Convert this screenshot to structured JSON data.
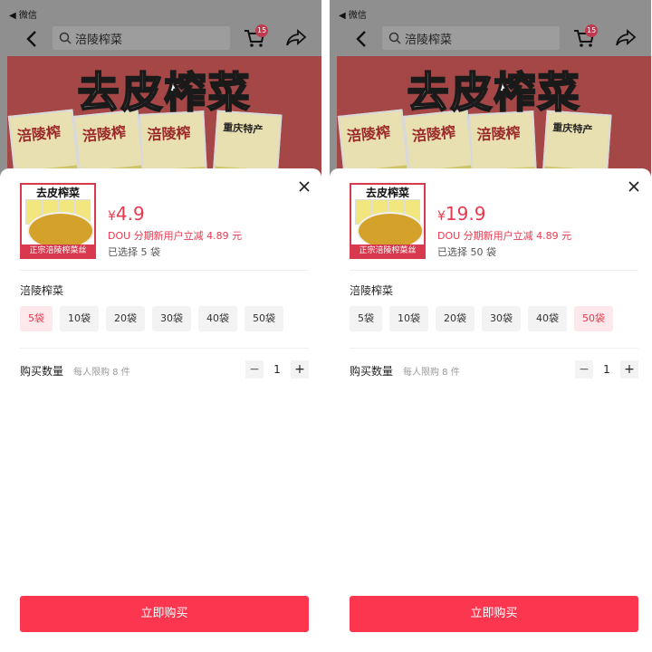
{
  "status_bar": {
    "back_app": "◀ 微信"
  },
  "navbar": {
    "search_text": "涪陵榨菜",
    "cart_badge": "15"
  },
  "hero": {
    "title": "去皮榨菜",
    "pack_text": [
      "涪陵榨",
      "涪陵榨",
      "重庆特产",
      "涪陵榨"
    ]
  },
  "thumbnail": {
    "top_text": "去皮榨菜",
    "bottom_text": "正宗涪陵榨菜丝"
  },
  "colors": {
    "accent": "#e8394f",
    "buy_button": "#fd3650",
    "selected_bg": "#fde9ec"
  },
  "panels": [
    {
      "price_symbol": "¥",
      "price_value": "4.9",
      "promo": "DOU 分期新用户立减 4.89 元",
      "selected_text": "已选择 5 袋",
      "group_label": "涪陵榨菜",
      "options": [
        "5袋",
        "10袋",
        "20袋",
        "30袋",
        "40袋",
        "50袋"
      ],
      "selected_option": "5袋",
      "quantity_label": "购买数量",
      "quantity_limit": "每人限购 8 件",
      "quantity": "1",
      "minus": "−",
      "plus": "+",
      "buy_label": "立即购买"
    },
    {
      "price_symbol": "¥",
      "price_value": "19.9",
      "promo": "DOU 分期新用户立减 4.89 元",
      "selected_text": "已选择 50 袋",
      "group_label": "涪陵榨菜",
      "options": [
        "5袋",
        "10袋",
        "20袋",
        "30袋",
        "40袋",
        "50袋"
      ],
      "selected_option": "50袋",
      "quantity_label": "购买数量",
      "quantity_limit": "每人限购 8 件",
      "quantity": "1",
      "minus": "−",
      "plus": "+",
      "buy_label": "立即购买"
    }
  ]
}
